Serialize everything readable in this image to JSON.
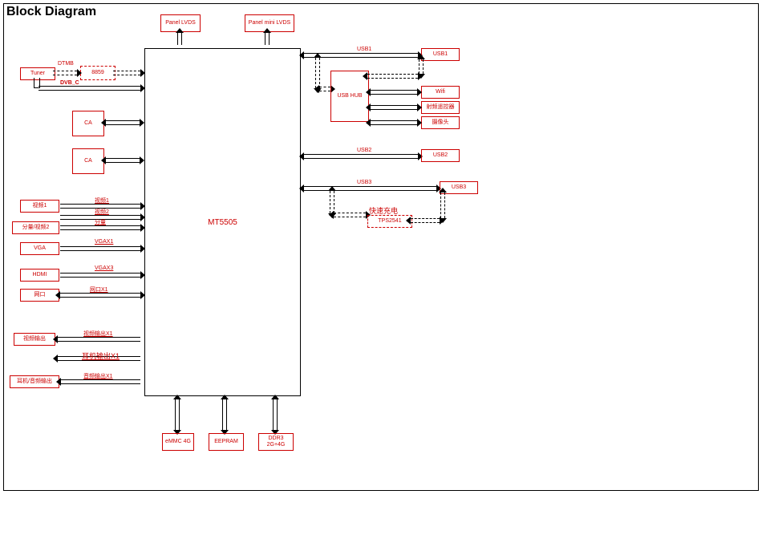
{
  "title": "Block Diagram",
  "main": "MT5505",
  "top": {
    "panel_lvds": "Panel\nLVDS",
    "panel_mini_lvds": "Panel\nmini LVDS"
  },
  "left": {
    "tuner": "Tuner",
    "dtmb": "DTMB",
    "b8859": "8859",
    "dvbc": "DVB_C",
    "ca1": "CA",
    "ca2": "CA",
    "video1_box": "视频1",
    "video1_lbl": "视频1",
    "video2_lbl": "视频2",
    "comp_video2": "分量/视频2",
    "comp_lbl": "分量",
    "vga": "VGA",
    "vgax1": "VGAX1",
    "hdmi": "HDMI",
    "vgax3": "VGAX3",
    "net": "网口",
    "netx1": "网口X1",
    "video_out": "视频输出",
    "video_out_x1": "视频输出X1",
    "headphone_x1": "耳机输出X1",
    "hp_audio_out": "耳机/音频输出",
    "audio_out_x1": "音频输出X1"
  },
  "bottom": {
    "emmc": "eMMC\n4G",
    "eepram": "EEPRAM",
    "ddr3": "DDR3\n2G+4G"
  },
  "right": {
    "usb1_lbl": "USB1",
    "usb1_box": "USB1",
    "usbhub": "USB HUB",
    "wifi": "Wifi",
    "rfrc": "射频遥控器",
    "camera": "摄像头",
    "usb2_lbl": "USB2",
    "usb2_box": "USB2",
    "usb3_lbl": "USB3",
    "usb3_box": "USB3",
    "fastcharge": "快速充电",
    "tps": "TPS2541"
  }
}
